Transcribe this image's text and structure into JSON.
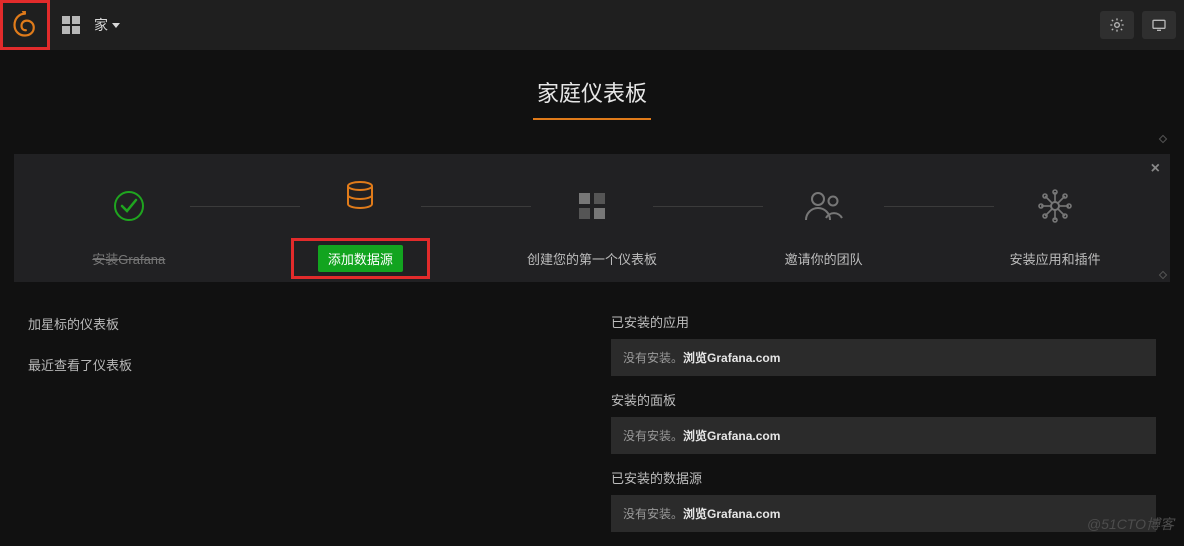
{
  "topbar": {
    "home_label": "家"
  },
  "page_title": "家庭仪表板",
  "getting_started": {
    "close": "×",
    "steps": [
      {
        "label": "安装Grafana"
      },
      {
        "label": "添加数据源"
      },
      {
        "label": "创建您的第一个仪表板"
      },
      {
        "label": "邀请你的团队"
      },
      {
        "label": "安装应用和插件"
      }
    ]
  },
  "left_panel": {
    "starred": "加星标的仪表板",
    "recent": "最近查看了仪表板"
  },
  "right_panel": {
    "sections": [
      {
        "title": "已安装的应用",
        "prefix": "没有安装。",
        "action": "浏览",
        "link": "Grafana.com"
      },
      {
        "title": "安装的面板",
        "prefix": "没有安装。",
        "action": "浏览",
        "link": "Grafana.com"
      },
      {
        "title": "已安装的数据源",
        "prefix": "没有安装。",
        "action": "浏览",
        "link": "Grafana.com"
      }
    ]
  },
  "watermark": "@51CTO博客"
}
